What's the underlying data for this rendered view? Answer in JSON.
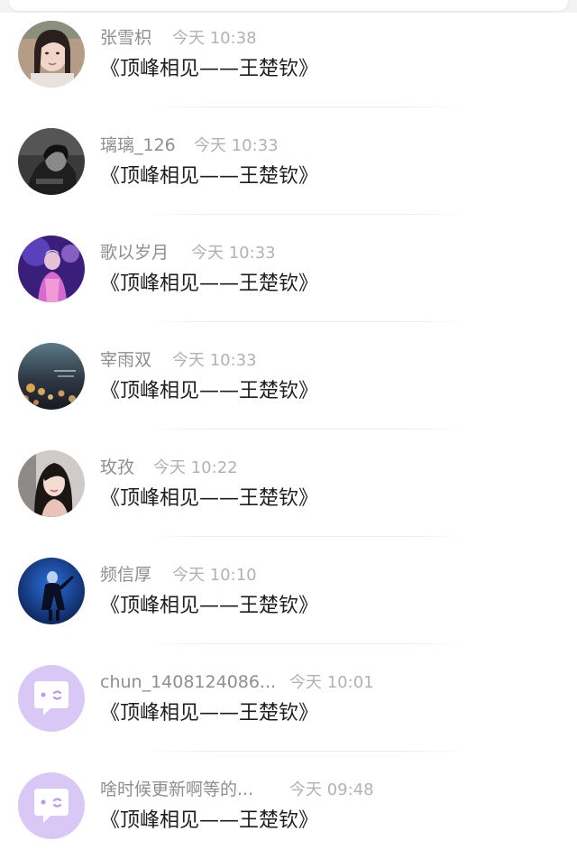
{
  "messages": [
    {
      "name": "张雪枳",
      "time": "今天 10:38",
      "text": "《顶峰相见——王楚钦》",
      "avatar": "photo-girl-portrait-avatar"
    },
    {
      "name": "璃璃_126",
      "time": "今天 10:33",
      "text": "《顶峰相见——王楚钦》",
      "avatar": "photo-dark-bw-avatar"
    },
    {
      "name": "歌以岁月",
      "time": "今天 10:33",
      "text": "《顶峰相见——王楚钦》",
      "avatar": "photo-purple-stage-avatar"
    },
    {
      "name": "宰雨双",
      "time": "今天 10:33",
      "text": "《顶峰相见——王楚钦》",
      "avatar": "photo-night-lights-avatar"
    },
    {
      "name": "玫孜",
      "time": "今天 10:22",
      "text": "《顶峰相见——王楚钦》",
      "avatar": "photo-woman-portrait-avatar"
    },
    {
      "name": "频信厚",
      "time": "今天 10:10",
      "text": "《顶峰相见——王楚钦》",
      "avatar": "photo-blue-figure-avatar"
    },
    {
      "name": "chun_1408124086...",
      "time": "今天 10:01",
      "text": "《顶峰相见——王楚钦》",
      "avatar": "chat-bubble-default-avatar"
    },
    {
      "name": "啥时候更新啊等的...",
      "time": "今天 09:48",
      "text": "《顶峰相见——王楚钦》",
      "avatar": "chat-bubble-default-avatar"
    }
  ],
  "colors": {
    "name": "#8e8e93",
    "time": "#b2b2b6",
    "message": "#1e1e1e",
    "default_avatar_bg": "#d9c8f5"
  }
}
